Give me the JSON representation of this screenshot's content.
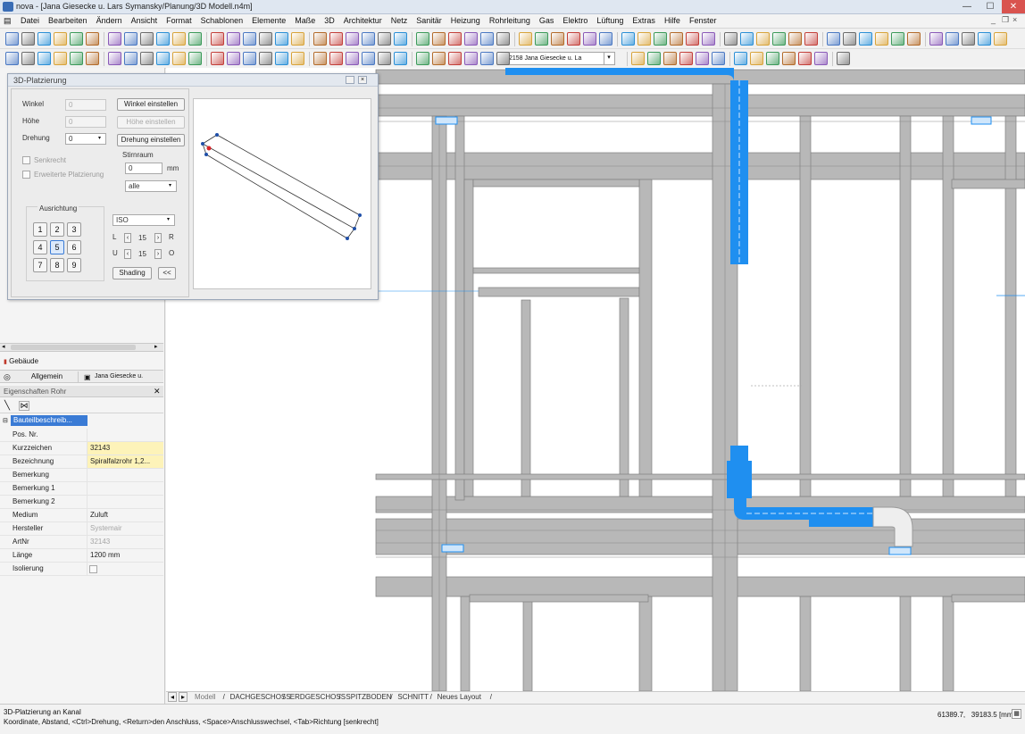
{
  "window": {
    "title": "nova - [Jana Giesecke u. Lars Symansky/Planung/3D Modell.n4m]",
    "minimize": "—",
    "maximize": "☐",
    "close": "✕"
  },
  "menu": [
    "Datei",
    "Bearbeiten",
    "Ändern",
    "Ansicht",
    "Format",
    "Schablonen",
    "Elemente",
    "Maße",
    "3D",
    "Architektur",
    "Netz",
    "Sanitär",
    "Heizung",
    "Rohrleitung",
    "Gas",
    "Elektro",
    "Lüftung",
    "Extras",
    "Hilfe",
    "Fenster"
  ],
  "toolbar": {
    "layer_dropdown": "2158 Jana Giesecke u. La"
  },
  "dialog": {
    "title": "3D-Platzierung",
    "winkel_label": "Winkel",
    "winkel_value": "0",
    "hoehe_label": "Höhe",
    "hoehe_value": "0",
    "drehung_label": "Drehung",
    "drehung_value": "0",
    "winkel_button": "Winkel einstellen",
    "hoehe_button": "Höhe einstellen",
    "drehung_button": "Drehung einstellen",
    "senkrecht_label": "Senkrecht",
    "erweitert_label": "Erweiterte Platzierung",
    "stirnraum_label": "Stirnraum",
    "stirnraum_value": "0",
    "stirnraum_unit": "mm",
    "stirnraum_select": "alle",
    "ausrichtung_label": "Ausrichtung",
    "numpad": [
      "1",
      "2",
      "3",
      "4",
      "5",
      "6",
      "7",
      "8",
      "9"
    ],
    "numpad_selected": "5",
    "view_select": "ISO",
    "l_label": "L",
    "r_label": "R",
    "u_label": "U",
    "o_label": "O",
    "lr_value": "15",
    "uo_value": "15",
    "shading_button": "Shading",
    "collapse_button": "<<"
  },
  "left": {
    "project_label": "Gebäude",
    "tab_general": "Allgemein",
    "tab_user": "Jana Giesecke u.",
    "props_title": "Eigenschaften Rohr",
    "group_label": "Bauteilbeschreib...",
    "rows": [
      {
        "key": "Pos. Nr.",
        "value": ""
      },
      {
        "key": "Kurzzeichen",
        "value": "32143"
      },
      {
        "key": "Bezeichnung",
        "value": "Spiralfalzrohr 1,2..."
      },
      {
        "key": "Bemerkung",
        "value": ""
      },
      {
        "key": "Bemerkung 1",
        "value": ""
      },
      {
        "key": "Bemerkung 2",
        "value": ""
      },
      {
        "key": "Medium",
        "value": "Zuluft"
      },
      {
        "key": "Hersteller",
        "value": "Systemair"
      },
      {
        "key": "ArtNr",
        "value": "32143"
      },
      {
        "key": "Länge",
        "value": "1200 mm"
      },
      {
        "key": "Isolierung",
        "value": ""
      }
    ]
  },
  "sheet_tabs": [
    "Modell",
    "DACHGESCHOSS",
    "ERDGESCHOSS",
    "SPITZBODEN",
    "SCHNITT",
    "Neues Layout"
  ],
  "status": {
    "line1": "3D-Platzierung an Kanal",
    "line2": "Koordinate, Abstand, <Ctrl>Drehung, <Return>den Anschluss, <Space>Anschlusswechsel, <Tab>Richtung [senkrecht]",
    "coords": "61389.7,   39183.5 [mm]"
  },
  "colors": {
    "duct": "#1f8ff0",
    "beam": "#b5b5b5",
    "beam_dark": "#9a9a9a",
    "yellow_cell": "#fdf3b9"
  }
}
